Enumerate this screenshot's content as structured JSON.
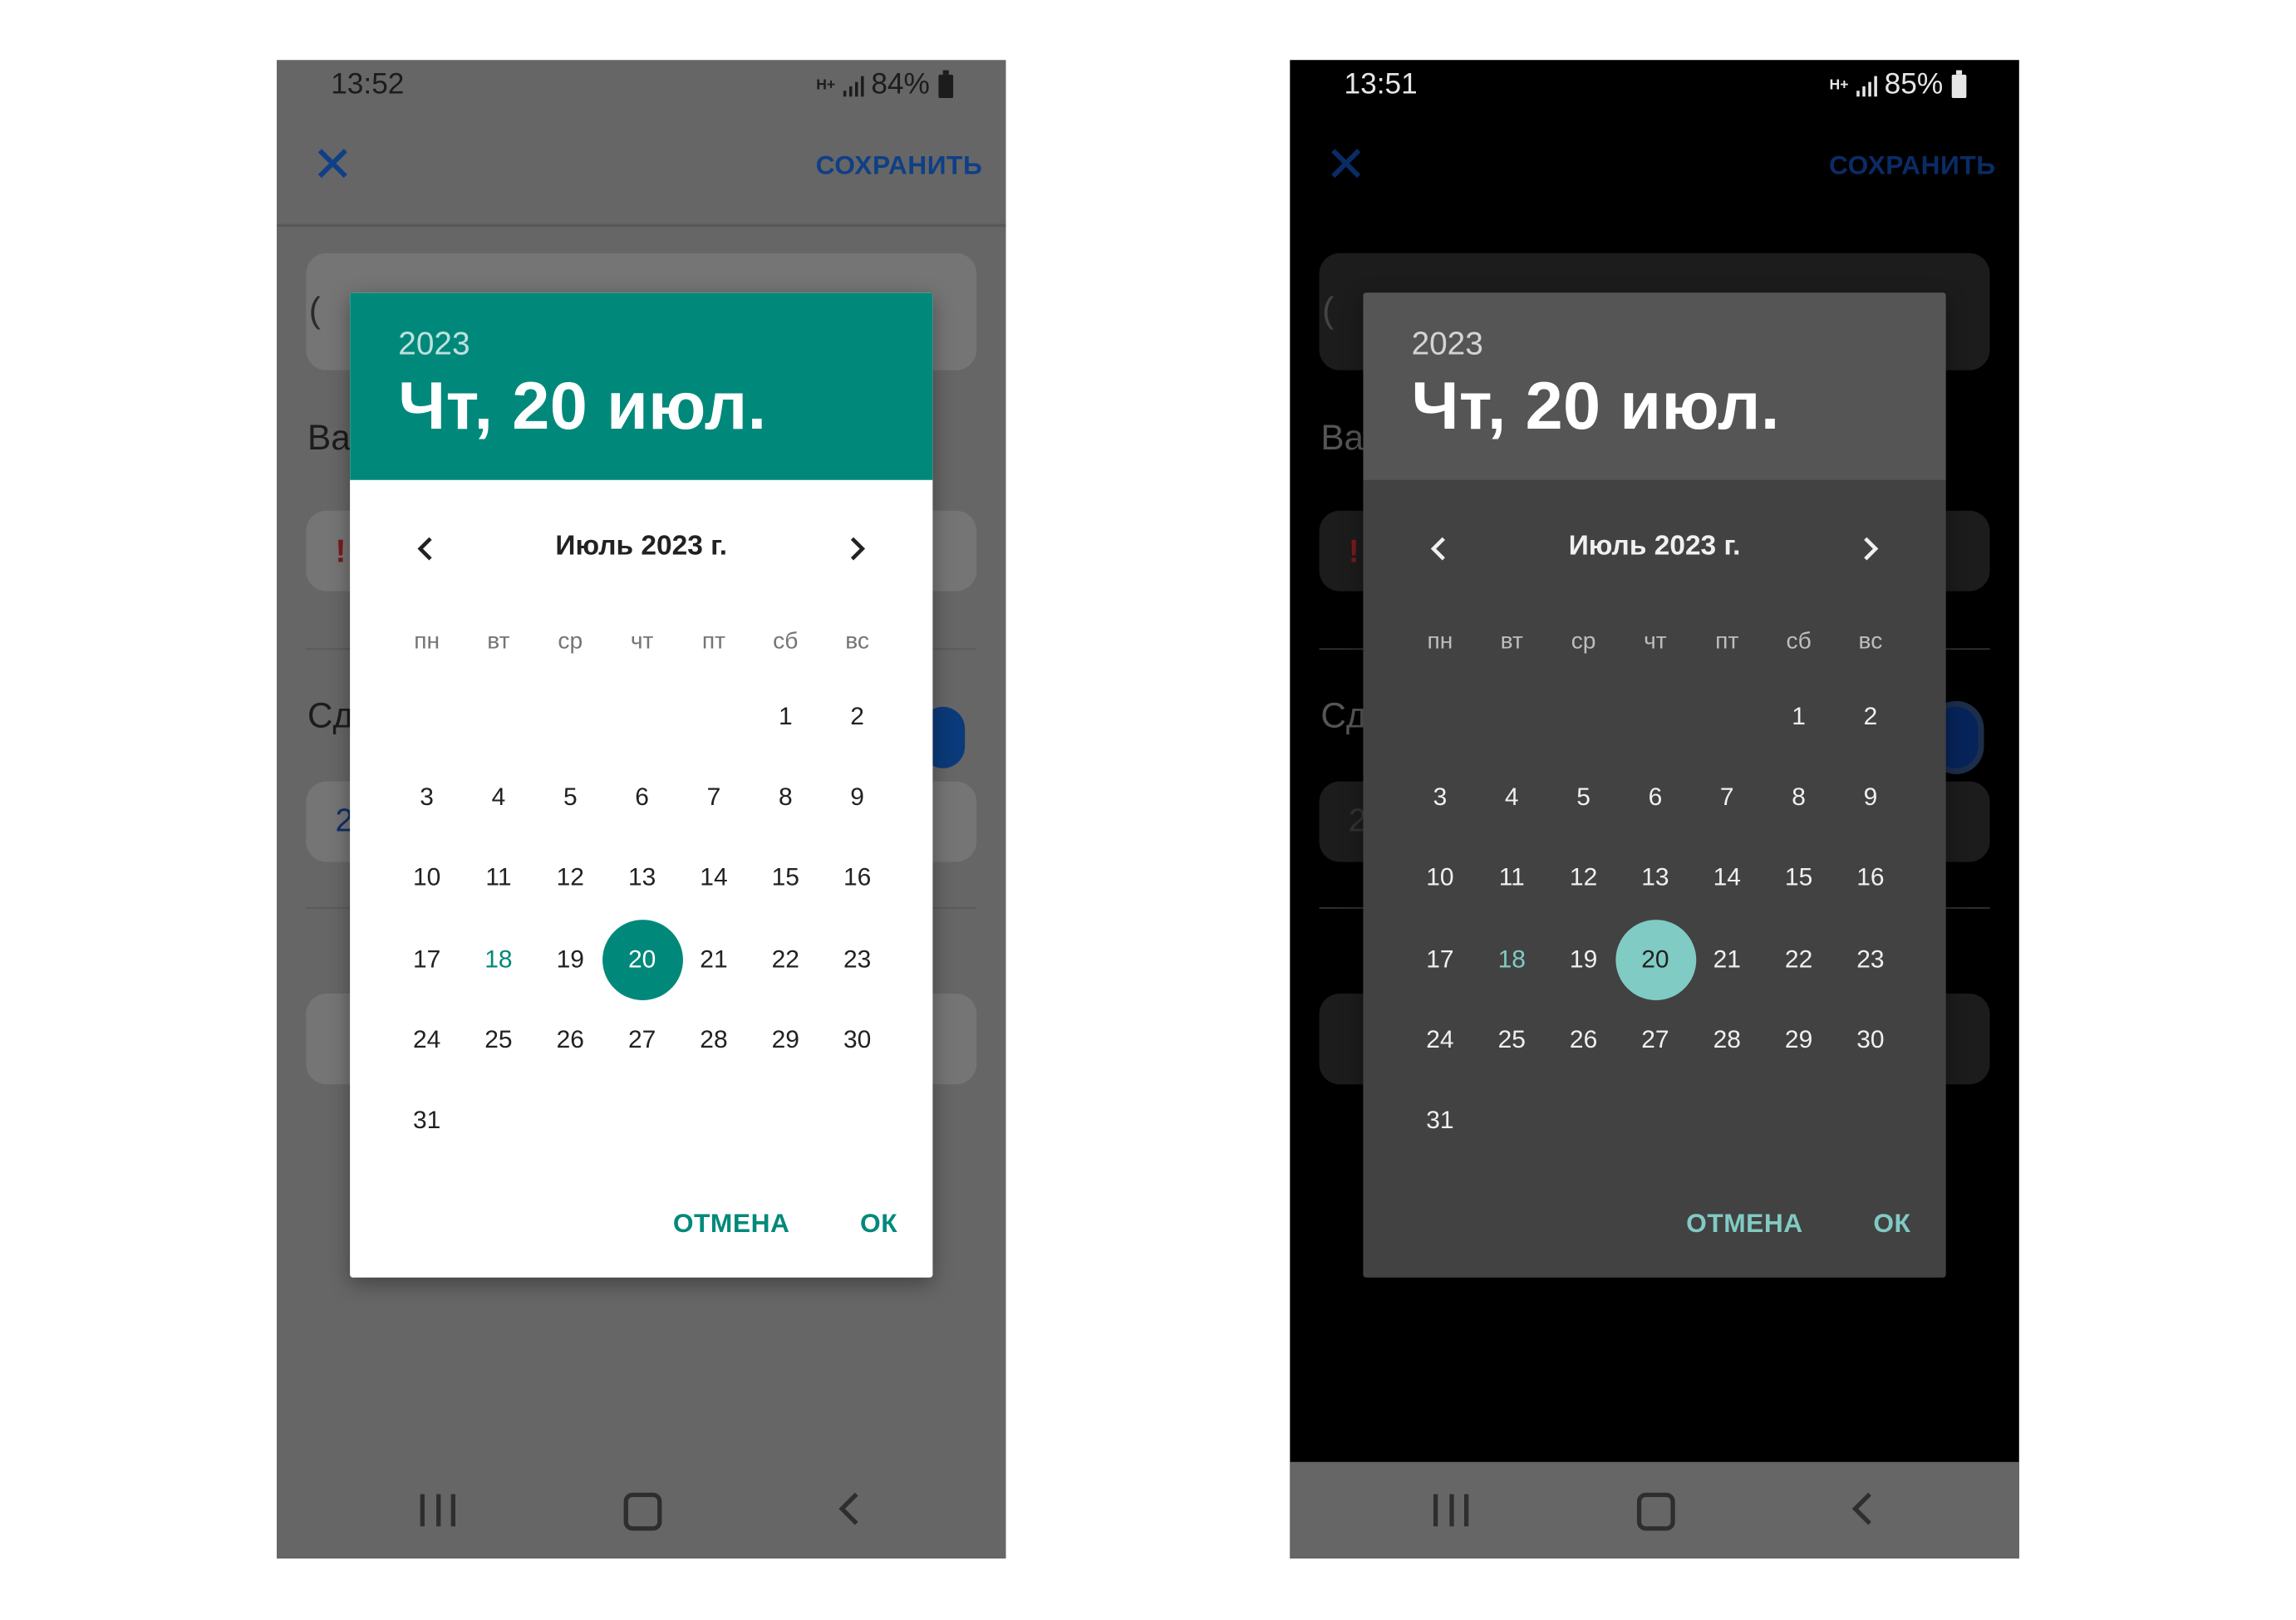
{
  "screens": [
    {
      "theme": "light",
      "status": {
        "time": "13:52",
        "net": "H+",
        "battery": "84%"
      },
      "appbar": {
        "close_icon": "close-icon",
        "save_label": "СОХРАНИТЬ"
      },
      "background_form": {
        "field1_text": "(",
        "label1": "Ва",
        "label2": "Сд",
        "excl": "!",
        "num": "2"
      },
      "dialog": {
        "year": "2023",
        "header_date": "Чт, 20 июл.",
        "month_label": "Июль 2023 г.",
        "weekdays": [
          "пн",
          "вт",
          "ср",
          "чт",
          "пт",
          "сб",
          "вс"
        ],
        "lead_blanks": 5,
        "days_in_month": 31,
        "today": 18,
        "selected": 20,
        "cancel_label": "ОТМЕНА",
        "ok_label": "ОК"
      }
    },
    {
      "theme": "dark",
      "status": {
        "time": "13:51",
        "net": "H+",
        "battery": "85%"
      },
      "appbar": {
        "close_icon": "close-icon",
        "save_label": "СОХРАНИТЬ"
      },
      "background_form": {
        "field1_text": "(",
        "label1": "Ва",
        "label2": "Сд",
        "excl": "!",
        "num": "2"
      },
      "dialog": {
        "year": "2023",
        "header_date": "Чт, 20 июл.",
        "month_label": "Июль 2023 г.",
        "weekdays": [
          "пн",
          "вт",
          "ср",
          "чт",
          "пт",
          "сб",
          "вс"
        ],
        "lead_blanks": 5,
        "days_in_month": 31,
        "today": 18,
        "selected": 20,
        "cancel_label": "ОТМЕНА",
        "ok_label": "ОК"
      }
    }
  ],
  "colors": {
    "accent_light": "#00897b",
    "accent_dark": "#80cbc4",
    "appbar_action": "#0f3f86"
  }
}
